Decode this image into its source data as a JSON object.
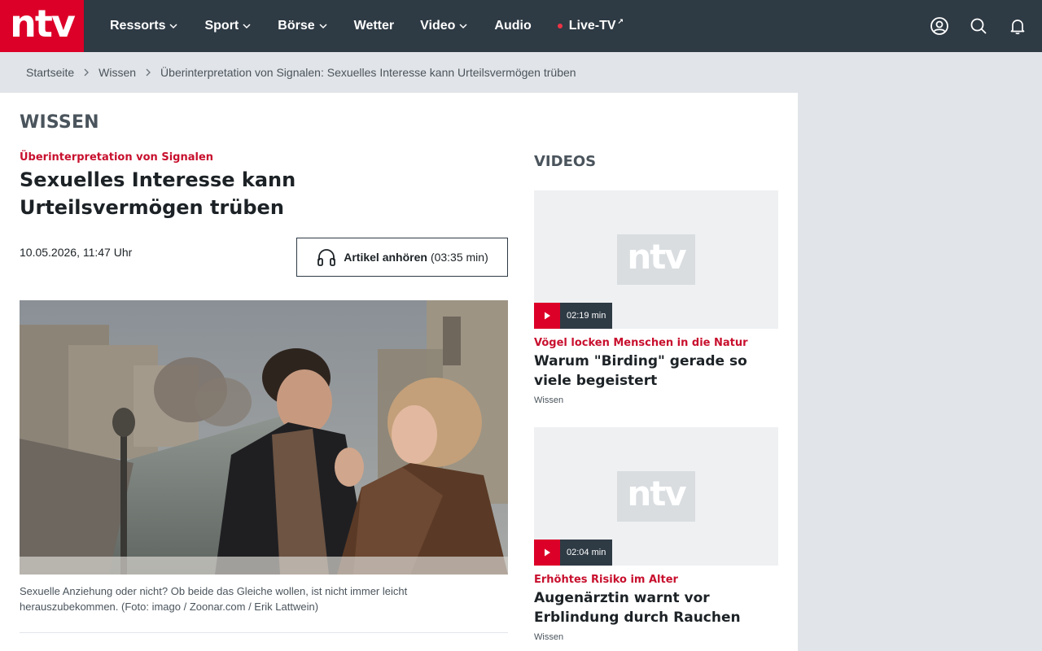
{
  "brand": {
    "logo_text": "ntv",
    "accent": "#dc0028",
    "nav_bg": "#2e3a44"
  },
  "nav": {
    "items": [
      {
        "label": "Ressorts",
        "has_dropdown": true
      },
      {
        "label": "Sport",
        "has_dropdown": true
      },
      {
        "label": "Börse",
        "has_dropdown": true
      },
      {
        "label": "Wetter",
        "has_dropdown": false
      },
      {
        "label": "Video",
        "has_dropdown": true
      },
      {
        "label": "Audio",
        "has_dropdown": false
      },
      {
        "label": "Live-TV",
        "has_dropdown": false,
        "live": true,
        "external": true
      }
    ],
    "icons": [
      "user-icon",
      "search-icon",
      "bell-icon"
    ]
  },
  "breadcrumb": {
    "items": [
      "Startseite",
      "Wissen",
      "Überinterpretation von Signalen: Sexuelles Interesse kann Urteilsvermögen trüben"
    ]
  },
  "section": {
    "title": "WISSEN"
  },
  "article": {
    "kicker": "Überinterpretation von Signalen",
    "headline": "Sexuelles Interesse kann Urteilsvermögen trüben",
    "date": "10.05.2026, 11:47 Uhr",
    "listen_label": "Artikel anhören",
    "listen_duration": "(03:35 min)",
    "caption": "Sexuelle Anziehung oder nicht? Ob beide das Gleiche wollen, ist nicht immer leicht herauszubekommen. (Foto: imago / Zoonar.com / Erik Lattwein)"
  },
  "sidebar": {
    "title": "VIDEOS",
    "videos": [
      {
        "duration": "02:19 min",
        "kicker": "Vögel locken Menschen in die Natur",
        "title": "Warum \"Birding\" gerade so viele begeistert",
        "section": "Wissen",
        "thumb_logo": "ntv"
      },
      {
        "duration": "02:04 min",
        "kicker": "Erhöhtes Risiko im Alter",
        "title": "Augenärztin warnt vor Erblindung durch Rauchen",
        "section": "Wissen",
        "thumb_logo": "ntv"
      }
    ]
  }
}
